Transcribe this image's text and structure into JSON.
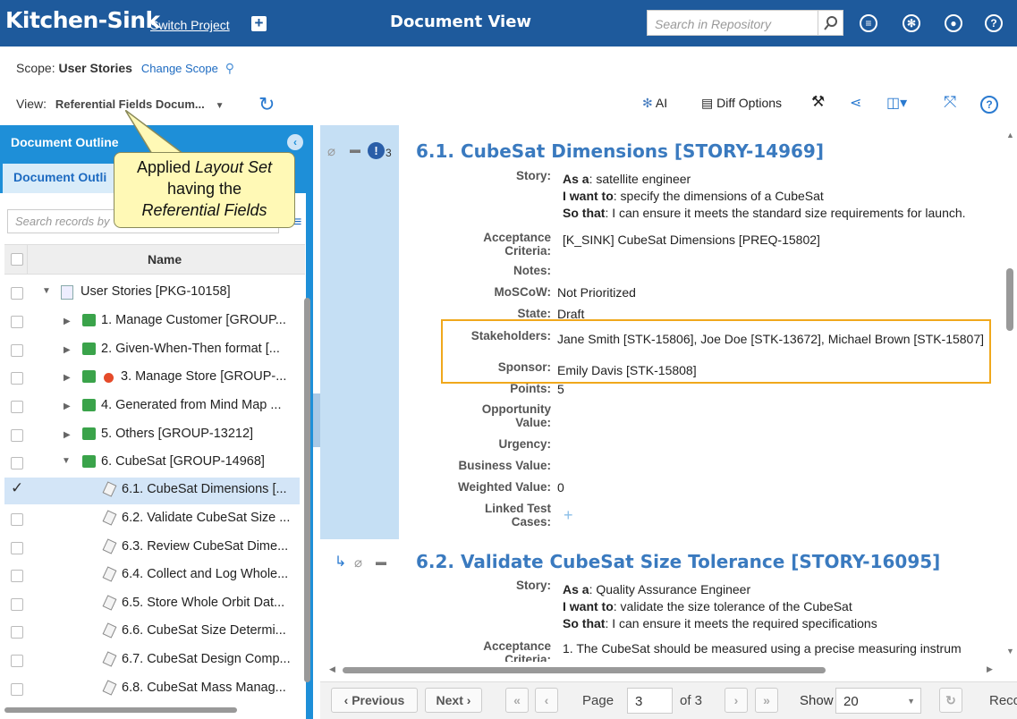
{
  "app": {
    "brand": "Kitchen-Sink",
    "switch_project": "Switch Project",
    "doc_title": "Document View",
    "search_placeholder": "Search in Repository"
  },
  "scope": {
    "label": "Scope:",
    "value": "User Stories",
    "change": "Change Scope"
  },
  "view": {
    "label": "View:",
    "value": "Referential Fields Docum...",
    "ai": "AI",
    "diff": "Diff Options"
  },
  "left": {
    "header": "Document Outline",
    "tab": "Document Outli",
    "search_placeholder": "Search records by",
    "col_name": "Name",
    "rows": [
      {
        "label": "User Stories [PKG-10158]"
      },
      {
        "label": "1. Manage Customer [GROUP..."
      },
      {
        "label": "2. Given-When-Then format [..."
      },
      {
        "label": "3. Manage Store [GROUP-..."
      },
      {
        "label": "4. Generated from Mind Map ..."
      },
      {
        "label": "5. Others [GROUP-13212]"
      },
      {
        "label": "6. CubeSat [GROUP-14968]"
      },
      {
        "label": "6.1. CubeSat Dimensions [..."
      },
      {
        "label": "6.2. Validate CubeSat Size ..."
      },
      {
        "label": "6.3. Review CubeSat Dime..."
      },
      {
        "label": "6.4. Collect and Log Whole..."
      },
      {
        "label": "6.5. Store Whole Orbit Dat..."
      },
      {
        "label": "6.6. CubeSat Size Determi..."
      },
      {
        "label": "6.7. CubeSat Design Comp..."
      },
      {
        "label": "6.8. CubeSat Mass Manag..."
      }
    ]
  },
  "callout": {
    "l1": "Applied ",
    "l1i": "Layout Set",
    "l2": "having the",
    "l3": "Referential Fields"
  },
  "gutter": {
    "count": "3"
  },
  "s1": {
    "title": "6.1.  CubeSat Dimensions [STORY-14969]",
    "story_label": "Story:",
    "as_a": "As a",
    "as_a_v": ": satellite engineer",
    "want": "I want to",
    "want_v": ": specify the dimensions of a CubeSat",
    "so": "So that",
    "so_v": ": I can ensure it meets the standard size requirements for launch.",
    "ac_label1": "Acceptance",
    "ac_label2": "Criteria:",
    "ac_value": "[K_SINK] CubeSat Dimensions [PREQ-15802]",
    "notes_label": "Notes:",
    "moscow_label": "MoSCoW:",
    "moscow_value": "Not Prioritized",
    "state_label": "State:",
    "state_value": "Draft",
    "stake_label": "Stakeholders:",
    "stake_value": "Jane Smith [STK-15806],  Joe Doe [STK-13672],  Michael Brown [STK-15807]",
    "sponsor_label": "Sponsor:",
    "sponsor_value": "Emily Davis [STK-15808]",
    "points_label": "Points:",
    "points_value": "5",
    "opp1": "Opportunity",
    "opp2": "Value:",
    "urg": "Urgency:",
    "bv": "Business Value:",
    "wv": "Weighted Value:",
    "wv_value": "0",
    "ltc1": "Linked Test",
    "ltc2": "Cases:"
  },
  "s2": {
    "title": "6.2.  Validate CubeSat Size Tolerance [STORY-16095]",
    "story_label": "Story:",
    "as_a": "As a",
    "as_a_v": ": Quality Assurance Engineer",
    "want": "I want to",
    "want_v": ": validate the size tolerance of the CubeSat",
    "so": "So that",
    "so_v": ": I can ensure it meets the required specifications",
    "ac_label1": "Acceptance",
    "ac_label2": "Criteria:",
    "ac_value": "1. The CubeSat should be measured using a precise measuring instrum"
  },
  "pager": {
    "previous": "Previous",
    "next": "Next",
    "page_label": "Page",
    "page_value": "3",
    "of": "of 3",
    "show": "Show",
    "show_value": "20",
    "rec": "Reco"
  }
}
